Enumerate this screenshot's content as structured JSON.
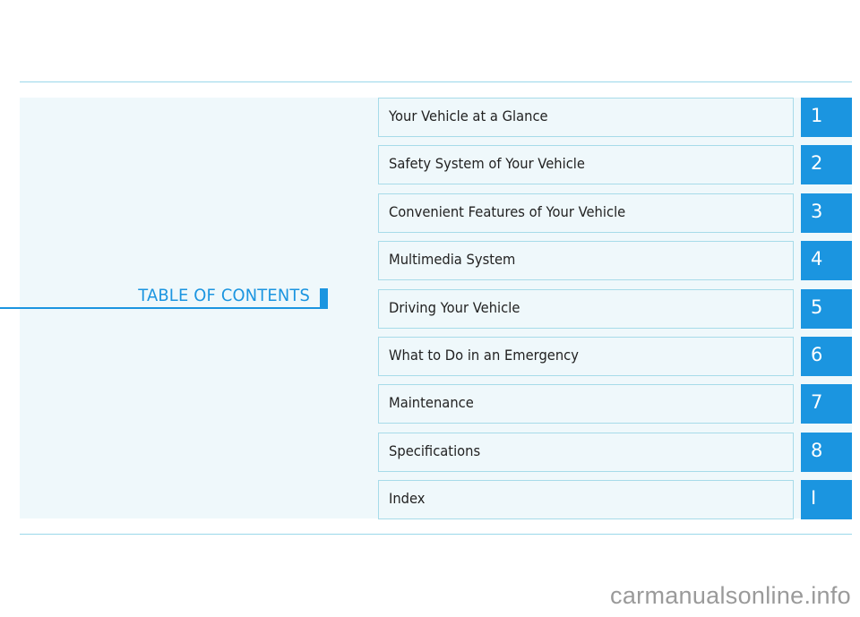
{
  "document": {
    "section_title": "TABLE OF CONTENTS",
    "colors": {
      "accent": "#1b95e0",
      "panel_background": "#eff8fb",
      "border": "#a7dbe9",
      "text": "#222222"
    },
    "chapters": [
      {
        "label": "Your Vehicle at a Glance",
        "number": "1"
      },
      {
        "label": "Safety System of Your Vehicle",
        "number": "2"
      },
      {
        "label": "Convenient Features of Your Vehicle",
        "number": "3"
      },
      {
        "label": "Multimedia System",
        "number": "4"
      },
      {
        "label": "Driving Your Vehicle",
        "number": "5"
      },
      {
        "label": "What to Do in an Emergency",
        "number": "6"
      },
      {
        "label": "Maintenance",
        "number": "7"
      },
      {
        "label": "Specifications",
        "number": "8"
      },
      {
        "label": "Index",
        "number": "I"
      }
    ]
  },
  "watermark": "carmanualsonline.info"
}
